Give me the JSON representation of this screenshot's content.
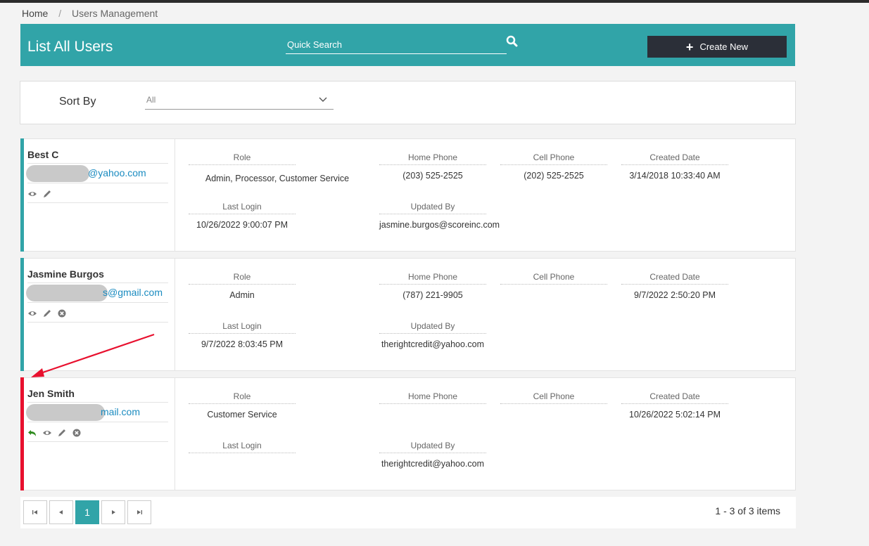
{
  "breadcrumb": {
    "home": "Home",
    "separator": "/",
    "current": "Users Management"
  },
  "header": {
    "title": "List All Users",
    "search_placeholder": "Quick Search",
    "create_label": "Create New",
    "accent": "#31a4a8"
  },
  "sort": {
    "label": "Sort By",
    "value": "All"
  },
  "field_labels": {
    "role": "Role",
    "home_phone": "Home Phone",
    "cell_phone": "Cell Phone",
    "created_date": "Created Date",
    "last_login": "Last Login",
    "updated_by": "Updated By"
  },
  "users": [
    {
      "name": "Best C",
      "email_visible": "@yahoo.com",
      "role": "Admin, Processor, Customer Service",
      "home_phone": "(203) 525-2525",
      "cell_phone": "(202) 525-2525",
      "created_date": "3/14/2018 10:33:40 AM",
      "last_login": "10/26/2022 9:00:07 PM",
      "updated_by": "jasmine.burgos@scoreinc.com",
      "status_color": "#31a4a8",
      "actions": [
        "eye-icon",
        "pencil-icon"
      ]
    },
    {
      "name": "Jasmine Burgos",
      "email_visible": "s@gmail.com",
      "role": "Admin",
      "home_phone": "(787) 221-9905",
      "cell_phone": "",
      "created_date": "9/7/2022 2:50:20 PM",
      "last_login": "9/7/2022 8:03:45 PM",
      "updated_by": "therightcredit@yahoo.com",
      "status_color": "#31a4a8",
      "actions": [
        "eye-icon",
        "pencil-icon",
        "delete-icon"
      ]
    },
    {
      "name": "Jen Smith",
      "email_visible": "mail.com",
      "role": "Customer Service",
      "home_phone": "",
      "cell_phone": "",
      "created_date": "10/26/2022 5:02:14 PM",
      "last_login": "",
      "updated_by": "therightcredit@yahoo.com",
      "status_color": "#e8102e",
      "actions": [
        "undo-icon",
        "eye-icon",
        "pencil-icon",
        "delete-icon"
      ]
    }
  ],
  "pagination": {
    "first_icon": "first-page-icon",
    "prev_icon": "prev-page-icon",
    "current_page": "1",
    "next_icon": "next-page-icon",
    "last_icon": "last-page-icon",
    "summary": "1 - 3 of 3 items"
  },
  "annotation": {
    "arrow_color": "#e8102e"
  }
}
